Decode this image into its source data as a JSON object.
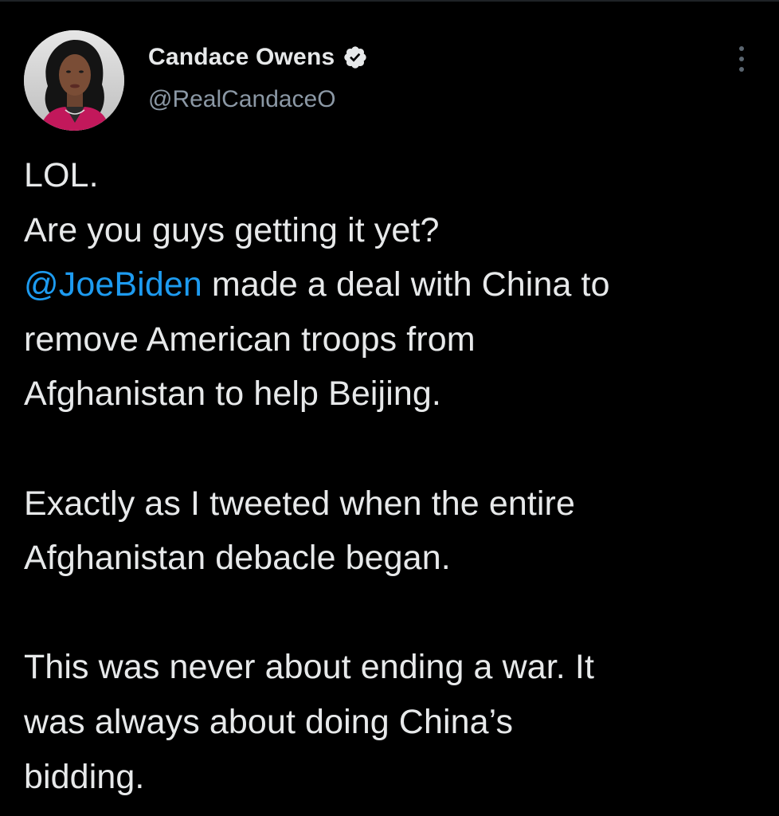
{
  "tweet": {
    "author": {
      "display_name": "Candace Owens",
      "handle": "@RealCandaceO",
      "verified_icon": "verified-badge-icon",
      "avatar": "profile-photo"
    },
    "more_icon": "more-options-icon",
    "text": {
      "line1": "LOL.",
      "line2": "Are you guys getting it yet?",
      "mention": "@JoeBiden",
      "line3_rest": " made a deal with China to",
      "line4": "remove American troops from",
      "line5": "Afghanistan to help Beijing.",
      "line6": "Exactly as I tweeted when the entire",
      "line7": "Afghanistan debacle began.",
      "line8": "This was never about ending a war. It",
      "line9": "was always about doing China’s",
      "line10": "bidding."
    }
  },
  "colors": {
    "background": "#000000",
    "text": "#e7e9ea",
    "secondary": "#8b98a5",
    "accent": "#1d9bf0"
  }
}
